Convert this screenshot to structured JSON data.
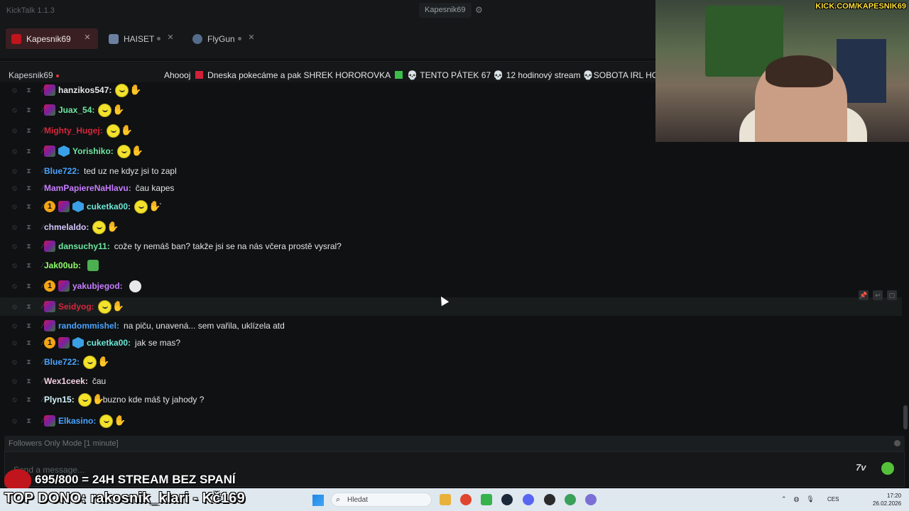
{
  "window": {
    "app_title": "KickTalk 1.1.3",
    "current_user": "Kapesnik69",
    "settings_icon": "gear-icon"
  },
  "tabs": [
    {
      "label": "Kapesnik69",
      "active": true,
      "color": "#c0151c"
    },
    {
      "label": "HAISET",
      "active": false,
      "color": "#6b7fa0"
    },
    {
      "label": "FlyGun",
      "active": false,
      "color": "#556b8a"
    }
  ],
  "channel": {
    "name": "Kapesnik69",
    "title_parts": [
      "Ahoooj",
      "Dneska pokecáme a pak SHREK HOROROVKA",
      "TENTO PÁTEK 67",
      "12 hodinový stream",
      "SOBOTA IRL HO"
    ]
  },
  "messages": [
    {
      "user": "hanzikos547:",
      "color": "#e8e8e8",
      "badges": [
        "sub"
      ],
      "text": "",
      "emotes": 2
    },
    {
      "user": "Juax_54:",
      "color": "#6ee7a1",
      "badges": [
        "sub"
      ],
      "text": "",
      "emotes": 2
    },
    {
      "user": "Mighty_Hugej:",
      "color": "#d7263d",
      "badges": [],
      "text": "",
      "emotes": 2
    },
    {
      "user": "Yorishiko:",
      "color": "#6ee7a1",
      "badges": [
        "sub",
        "cube"
      ],
      "text": "",
      "emotes": 2
    },
    {
      "user": "Blue722:",
      "color": "#4aa3ff",
      "badges": [],
      "text": "ted uz ne kdyz jsi to zapl",
      "emotes": 0
    },
    {
      "user": "MamPapiereNaHlavu:",
      "color": "#c77dff",
      "badges": [],
      "text": "čau kapes",
      "emotes": 0
    },
    {
      "user": "cuketka00:",
      "color": "#6ee7d7",
      "badges": [
        "one",
        "sub",
        "cube"
      ],
      "text": "`",
      "emotes": 2
    },
    {
      "user": "chmelaldo:",
      "color": "#d6c6ff",
      "badges": [],
      "text": "",
      "emotes": 2
    },
    {
      "user": "dansuchy11:",
      "color": "#6ee7a1",
      "badges": [
        "sub"
      ],
      "text": "cože ty nemáš ban? takže jsi se na nás včera prostě vysral?",
      "emotes": 0
    },
    {
      "user": "Jak00ub:",
      "color": "#8fff6a",
      "badges": [],
      "text": "",
      "emotes": 0,
      "special": "frog"
    },
    {
      "user": "yakubjegod:",
      "color": "#c77dff",
      "badges": [
        "one",
        "sub"
      ],
      "text": "",
      "emotes": 0,
      "special": "skull"
    },
    {
      "user": "Seidyog:",
      "color": "#d7263d",
      "badges": [
        "sub"
      ],
      "text": "",
      "emotes": 2
    },
    {
      "user": "randommishel:",
      "color": "#4aa3ff",
      "badges": [
        "sub"
      ],
      "text": "na piču, unavená... sem vařila, uklízela atd",
      "emotes": 0
    },
    {
      "user": "cuketka00:",
      "color": "#6ee7d7",
      "badges": [
        "one",
        "sub",
        "cube"
      ],
      "text": "jak se mas?",
      "emotes": 0
    },
    {
      "user": "Blue722:",
      "color": "#4aa3ff",
      "badges": [],
      "text": "",
      "emotes": 2
    },
    {
      "user": "Wex1ceek:",
      "color": "#f4d0e0",
      "badges": [],
      "text": "čau",
      "emotes": 0
    },
    {
      "user": "Plyn15:",
      "color": "#d6f5ff",
      "badges": [],
      "text": "buzno kde máš ty jahody ?",
      "emotes": 2,
      "emote_before_text": true
    },
    {
      "user": "Elkasino:",
      "color": "#4aa3ff",
      "badges": [
        "sub"
      ],
      "text": "",
      "emotes": 2
    }
  ],
  "mode_notice": "Followers Only Mode [1 minute]",
  "input": {
    "placeholder": "Send a message...",
    "value": ""
  },
  "overlays": {
    "goal": "695/800 = 24H STREAM BEZ SPANÍ",
    "top_donor": "TOP DONO: rakosnik_klari - Kč169",
    "webcam_url": "KICK.COM/KAPESNIK69"
  },
  "taskbar": {
    "search_placeholder": "Hledat",
    "language": "CES",
    "time": "17:20",
    "date": "26.02.2026"
  }
}
